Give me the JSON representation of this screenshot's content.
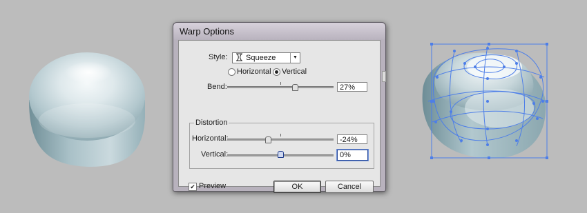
{
  "dialog": {
    "title": "Warp Options",
    "style_label": "Style:",
    "style_value": "Squeeze",
    "style_icon": "squeeze-warp-icon",
    "orientation": {
      "horizontal_label": "Horizontal",
      "vertical_label": "Vertical",
      "selected": "Vertical"
    },
    "bend": {
      "label": "Bend:",
      "value": "27%",
      "level": 27
    },
    "distortion": {
      "group_label": "Distortion",
      "horizontal": {
        "label": "Horizontal:",
        "value": "-24%",
        "level": -24
      },
      "vertical": {
        "label": "Vertical:",
        "value": "0%",
        "level": 0
      }
    },
    "preview": {
      "label": "Preview",
      "checked": true
    },
    "ok_label": "OK",
    "cancel_label": "Cancel"
  },
  "colors": {
    "canvas": "#bcbcbc",
    "selection": "#4d7ee8",
    "drop_light": "#eef3f5",
    "drop_dark": "#6e8f99"
  }
}
